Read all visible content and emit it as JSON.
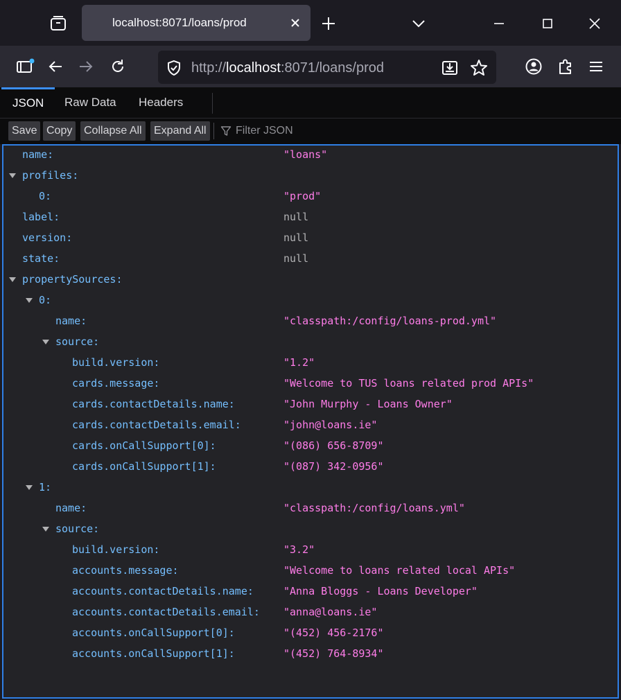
{
  "tab": {
    "title": "localhost:8071/loans/prod"
  },
  "urlbar": {
    "protocol": "http://",
    "host": "localhost",
    "rest": ":8071/loans/prod"
  },
  "viewer": {
    "tabs": [
      {
        "label": "JSON",
        "selected": true
      },
      {
        "label": "Raw Data",
        "selected": false
      },
      {
        "label": "Headers",
        "selected": false
      }
    ],
    "toolbar": {
      "save": "Save",
      "copy": "Copy",
      "collapse_all": "Collapse All",
      "expand_all": "Expand All",
      "filter_placeholder": "Filter JSON"
    }
  },
  "json_rows": [
    {
      "key": "name:",
      "value": "\"loans\"",
      "type": "string",
      "depth": 0,
      "expandable": false
    },
    {
      "key": "profiles:",
      "value": "",
      "type": "object",
      "depth": 0,
      "expandable": true
    },
    {
      "key": "0:",
      "value": "\"prod\"",
      "type": "string",
      "depth": 1,
      "expandable": false
    },
    {
      "key": "label:",
      "value": "null",
      "type": "null",
      "depth": 0,
      "expandable": false
    },
    {
      "key": "version:",
      "value": "null",
      "type": "null",
      "depth": 0,
      "expandable": false
    },
    {
      "key": "state:",
      "value": "null",
      "type": "null",
      "depth": 0,
      "expandable": false
    },
    {
      "key": "propertySources:",
      "value": "",
      "type": "object",
      "depth": 0,
      "expandable": true
    },
    {
      "key": "0:",
      "value": "",
      "type": "object",
      "depth": 1,
      "expandable": true
    },
    {
      "key": "name:",
      "value": "\"classpath:/config/loans-prod.yml\"",
      "type": "string",
      "depth": 2,
      "expandable": false
    },
    {
      "key": "source:",
      "value": "",
      "type": "object",
      "depth": 2,
      "expandable": true
    },
    {
      "key": "build.version:",
      "value": "\"1.2\"",
      "type": "string",
      "depth": 3,
      "expandable": false
    },
    {
      "key": "cards.message:",
      "value": "\"Welcome to TUS loans related prod APIs\"",
      "type": "string",
      "depth": 3,
      "expandable": false
    },
    {
      "key": "cards.contactDetails.name:",
      "value": "\"John Murphy - Loans Owner\"",
      "type": "string",
      "depth": 3,
      "expandable": false
    },
    {
      "key": "cards.contactDetails.email:",
      "value": "\"john@loans.ie\"",
      "type": "string",
      "depth": 3,
      "expandable": false
    },
    {
      "key": "cards.onCallSupport[0]:",
      "value": "\"(086) 656-8709\"",
      "type": "string",
      "depth": 3,
      "expandable": false
    },
    {
      "key": "cards.onCallSupport[1]:",
      "value": "\"(087) 342-0956\"",
      "type": "string",
      "depth": 3,
      "expandable": false
    },
    {
      "key": "1:",
      "value": "",
      "type": "object",
      "depth": 1,
      "expandable": true
    },
    {
      "key": "name:",
      "value": "\"classpath:/config/loans.yml\"",
      "type": "string",
      "depth": 2,
      "expandable": false
    },
    {
      "key": "source:",
      "value": "",
      "type": "object",
      "depth": 2,
      "expandable": true
    },
    {
      "key": "build.version:",
      "value": "\"3.2\"",
      "type": "string",
      "depth": 3,
      "expandable": false
    },
    {
      "key": "accounts.message:",
      "value": "\"Welcome to loans related local APIs\"",
      "type": "string",
      "depth": 3,
      "expandable": false
    },
    {
      "key": "accounts.contactDetails.name:",
      "value": "\"Anna Bloggs - Loans Developer\"",
      "type": "string",
      "depth": 3,
      "expandable": false
    },
    {
      "key": "accounts.contactDetails.email:",
      "value": "\"anna@loans.ie\"",
      "type": "string",
      "depth": 3,
      "expandable": false
    },
    {
      "key": "accounts.onCallSupport[0]:",
      "value": "\"(452) 456-2176\"",
      "type": "string",
      "depth": 3,
      "expandable": false
    },
    {
      "key": "accounts.onCallSupport[1]:",
      "value": "\"(452) 764-8934\"",
      "type": "string",
      "depth": 3,
      "expandable": false
    }
  ],
  "colors": {
    "key": "#75bfff",
    "string": "#ff7de9",
    "null": "#b1b1b3",
    "accent": "#2f7fe5"
  }
}
